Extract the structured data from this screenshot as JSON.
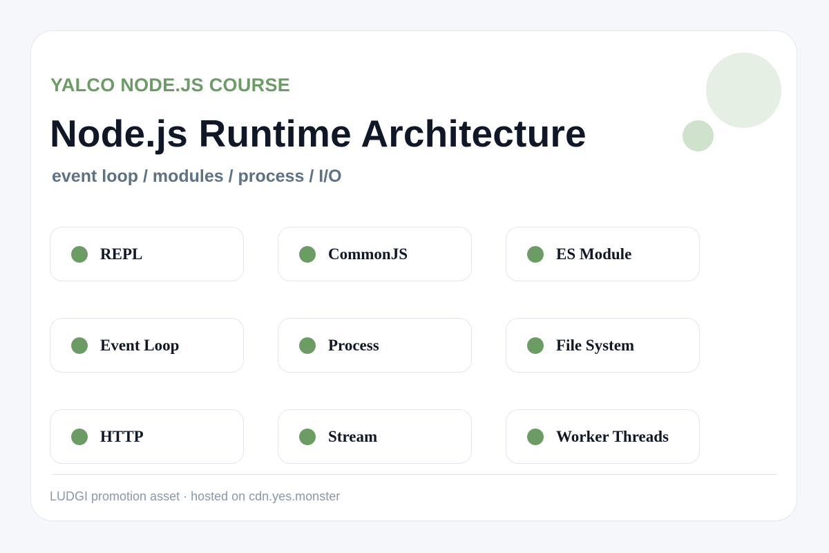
{
  "header": {
    "kicker": "YALCO NODE.JS COURSE",
    "title": "Node.js Runtime Architecture",
    "subtitle": "event loop / modules / process / I/O"
  },
  "topics": [
    {
      "label": "REPL"
    },
    {
      "label": "CommonJS"
    },
    {
      "label": "ES Module"
    },
    {
      "label": "Event Loop"
    },
    {
      "label": "Process"
    },
    {
      "label": "File System"
    },
    {
      "label": "HTTP"
    },
    {
      "label": "Stream"
    },
    {
      "label": "Worker Threads"
    }
  ],
  "footer": {
    "text": "LUDGI promotion asset · hosted on cdn.yes.monster"
  },
  "colors": {
    "accent": "#6a9c63",
    "title": "#101828",
    "subtitle": "#5f7185",
    "footer": "#8a98a8",
    "page_background": "#f5f7fb",
    "card_background": "#ffffff"
  }
}
